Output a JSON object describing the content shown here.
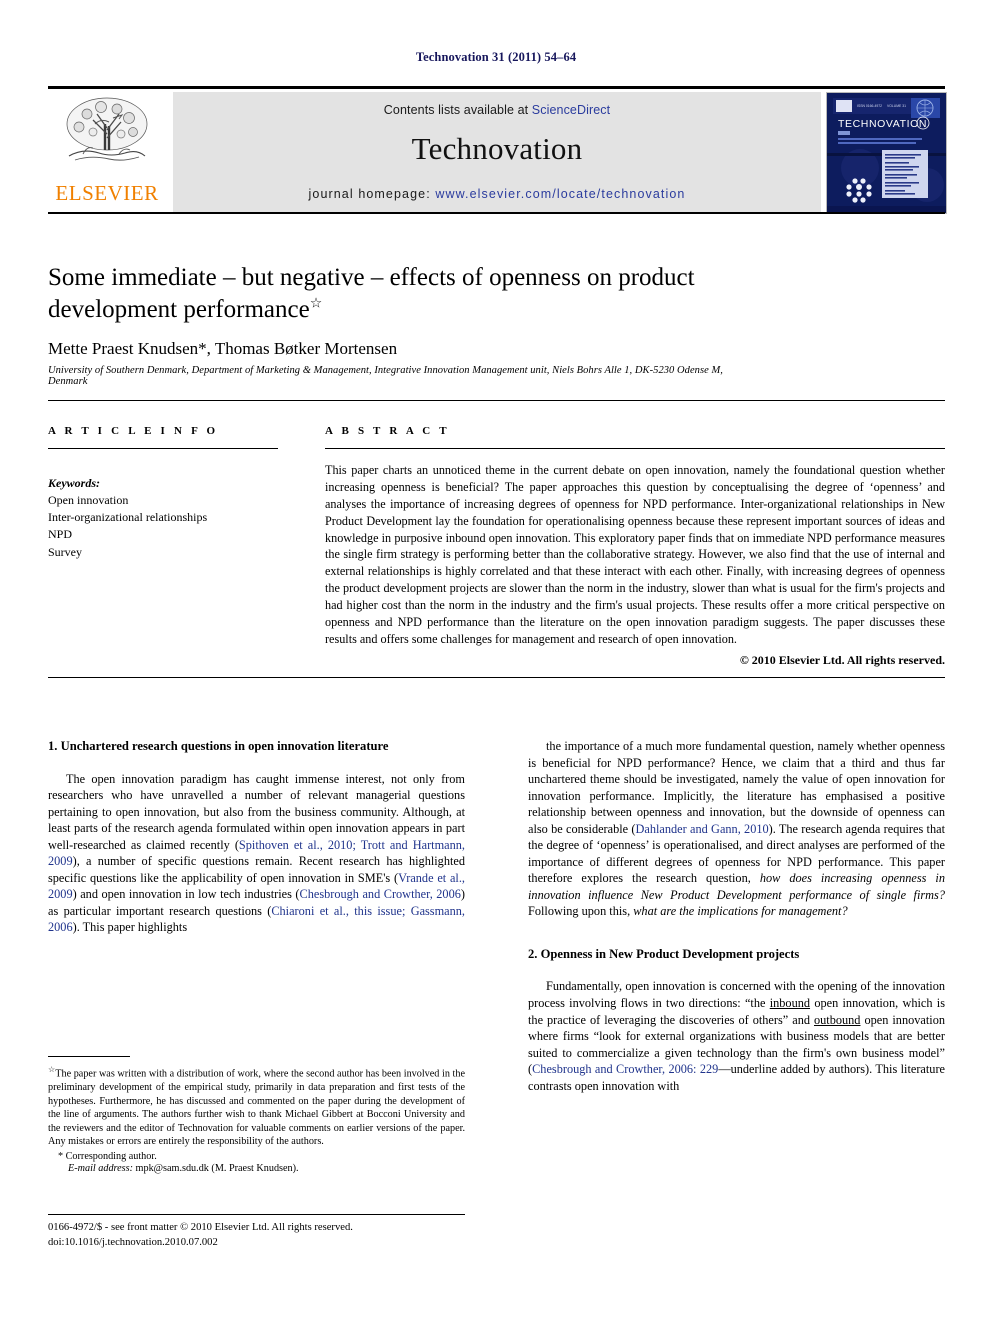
{
  "running_head": "Technovation 31 (2011) 54–64",
  "masthead": {
    "contents_prefix": "Contents lists available at ",
    "contents_link": "ScienceDirect",
    "journal_name": "Technovation",
    "homepage_prefix": "journal homepage: ",
    "homepage_link": "www.elsevier.com/locate/technovation",
    "publisher": "ELSEVIER",
    "cover_title": "TECHNOVATION"
  },
  "article": {
    "title": "Some immediate – but negative – effects of openness on product development performance",
    "title_footnote_marker": "☆",
    "authors": "Mette Praest Knudsen*, Thomas Bøtker Mortensen",
    "affiliation": "University of Southern Denmark, Department of Marketing & Management, Integrative Innovation Management unit, Niels Bohrs Alle 1, DK-5230 Odense M, Denmark"
  },
  "article_info": {
    "heading": "A R T I C L E   I N F O",
    "keywords_label": "Keywords:",
    "keywords": [
      "Open innovation",
      "Inter-organizational relationships",
      "NPD",
      "Survey"
    ]
  },
  "abstract": {
    "heading": "A B S T R A C T",
    "text": "This paper charts an unnoticed theme in the current debate on open innovation, namely the foundational question whether increasing openness is beneficial? The paper approaches this question by conceptualising the degree of ‘openness’ and analyses the importance of increasing degrees of openness for NPD performance. Inter-organizational relationships in New Product Development lay the foundation for operationalising openness because these represent important sources of ideas and knowledge in purposive inbound open innovation. This exploratory paper finds that on immediate NPD performance measures the single firm strategy is performing better than the collaborative strategy. However, we also find that the use of internal and external relationships is highly correlated and that these interact with each other. Finally, with increasing degrees of openness the product development projects are slower than the norm in the industry, slower than what is usual for the firm's projects and had higher cost than the norm in the industry and the firm's usual projects. These results offer a more critical perspective on openness and NPD performance than the literature on the open innovation paradigm suggests. The paper discusses these results and offers some challenges for management and research of open innovation.",
    "copyright": "© 2010 Elsevier Ltd. All rights reserved."
  },
  "sections": {
    "section1_heading": "1.  Unchartered research questions in open innovation literature",
    "section2_heading": "2.  Openness in New Product Development projects"
  },
  "body": {
    "col1_p1_a": "The open innovation paradigm has caught immense interest, not only from researchers who have unravelled a number of relevant managerial questions pertaining to open innovation, but also from the business community. Although, at least parts of the research agenda formulated within open innovation appears in part well-researched as claimed recently (",
    "col1_cite1": "Spithoven et al., 2010; Trott and Hartmann, 2009",
    "col1_p1_b": "), a number of specific questions remain. Recent research has highlighted specific questions like the applicability of open innovation in SME's (",
    "col1_cite2": "Vrande et al., 2009",
    "col1_p1_c": ") and open innovation in low tech industries (",
    "col1_cite3": "Chesbrough and Crowther, 2006",
    "col1_p1_d": ") as particular important research questions (",
    "col1_cite4": "Chiaroni et al., this issue; Gassmann, 2006",
    "col1_p1_e": "). This paper highlights",
    "col2_p1_a": "the importance of a much more fundamental question, namely whether openness is beneficial for NPD performance? Hence, we claim that a third and thus far unchartered theme should be investigated, namely the value of open innovation for innovation performance. Implicitly, the literature has emphasised a positive relationship between openness and innovation, but the downside of openness can also be considerable (",
    "col2_cite1": "Dahlander and Gann, 2010",
    "col2_p1_b": "). The research agenda requires that the degree of ‘openness’ is operationalised, and direct analyses are performed of the importance of different degrees of openness for NPD performance. This paper therefore explores the research question, ",
    "col2_p1_ital1": "how does increasing openness in innovation influence New Product Development performance of single firms?",
    "col2_p1_c": " Following upon this, ",
    "col2_p1_ital2": "what are the implications for management?",
    "col2_p2_a": "Fundamentally, open innovation is concerned with the opening of the innovation process involving flows in two directions: “the ",
    "col2_p2_u1": "inbound",
    "col2_p2_b": " open innovation, which is the practice of leveraging the discoveries of others” and ",
    "col2_p2_u2": "outbound",
    "col2_p2_c": " open innovation where firms “look for external organizations with business models that are better suited to commercialize a given technology than the firm's own business model” (",
    "col2_cite2": "Chesbrough and Crowther, 2006: 229",
    "col2_p2_d": "—underline added by authors). This literature contrasts open innovation with"
  },
  "footnote": {
    "star": "☆",
    "text": "The paper was written with a distribution of work, where the second author has been involved in the preliminary development of the empirical study, primarily in data preparation and first tests of the hypotheses. Furthermore, he has discussed and commented on the paper during the development of the line of arguments. The authors further wish to thank Michael Gibbert at Bocconi University and the reviewers and the editor of Technovation for valuable comments on earlier versions of the paper. Any mistakes or errors are entirely the responsibility of the authors.",
    "corresponding": "* Corresponding author.",
    "email_label": "E-mail address:",
    "email_value": "mpk@sam.sdu.dk (M. Praest Knudsen)."
  },
  "page_footer": {
    "issn_line": "0166-4972/$ - see front matter © 2010 Elsevier Ltd. All rights reserved.",
    "doi_line": "doi:10.1016/j.technovation.2010.07.002"
  }
}
